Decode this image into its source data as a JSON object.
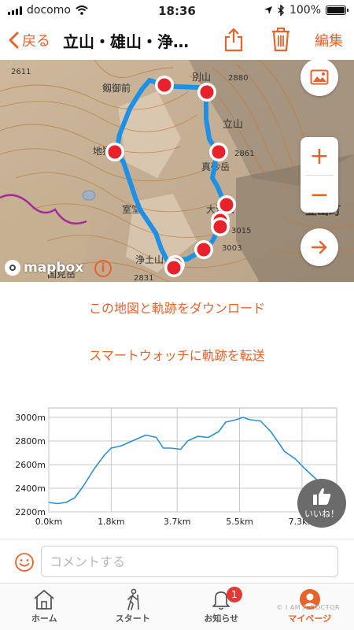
{
  "status_bar": {
    "carrier": "docomo",
    "time": "18:36",
    "battery": "100%"
  },
  "nav": {
    "back_label": "戻る",
    "title": "立山・雄山・浄…",
    "edit_label": "編集"
  },
  "map": {
    "provider": "mapbox",
    "labels": {
      "summit_2611": "2611",
      "tsurugi": "剱御前",
      "bessan": "別山",
      "elev_2880": "2880",
      "tateyama": "立山",
      "elev_2861": "2861",
      "masago": "真砂岳",
      "jigoku": "地獄",
      "murodo": "室堂",
      "oyama": "大汝山",
      "elev_3015": "3015",
      "elev_3003": "3003",
      "jodo": "浄土山",
      "kokken": "国見岳",
      "elev_2831": "2831",
      "town": "立山町"
    },
    "icons": {
      "image": "image-icon",
      "zoom_in": "plus-icon",
      "zoom_out": "minus-icon",
      "next": "arrow-right-icon",
      "info": "info-icon"
    },
    "zoom_in": "+",
    "zoom_out": "−",
    "info": "i"
  },
  "actions": {
    "download": "この地図と軌跡をダウンロード",
    "send_watch": "スマートウォッチに軌跡を転送"
  },
  "chart_data": {
    "type": "area",
    "x_unit": "km",
    "xlim": [
      0,
      8.3
    ],
    "ylim": [
      2200,
      3080
    ],
    "yticks": [
      "2200m",
      "2400m",
      "2600m",
      "2800m",
      "3000m"
    ],
    "ytick_values": [
      2200,
      2400,
      2600,
      2800,
      3000
    ],
    "xticks": [
      "0.0km",
      "1.8km",
      "3.7km",
      "5.5km",
      "7.3km"
    ],
    "xtick_values": [
      0,
      1.8,
      3.7,
      5.5,
      7.3
    ],
    "grid": true,
    "color": "#2b8fd6",
    "series": [
      {
        "x": [
          0,
          0.25,
          0.5,
          0.75,
          1.0,
          1.3,
          1.6,
          1.8,
          2.1,
          2.4,
          2.8,
          3.1,
          3.3,
          3.5,
          3.8,
          4.0,
          4.3,
          4.6,
          4.9,
          5.1,
          5.4,
          5.6,
          5.8,
          6.1,
          6.4,
          6.8,
          7.1,
          7.4,
          7.7,
          8.0
        ],
        "y": [
          2280,
          2270,
          2280,
          2320,
          2420,
          2560,
          2680,
          2740,
          2760,
          2800,
          2850,
          2830,
          2740,
          2740,
          2730,
          2800,
          2840,
          2830,
          2880,
          2960,
          2980,
          3000,
          2980,
          2970,
          2880,
          2710,
          2650,
          2560,
          2480,
          2390
        ]
      }
    ]
  },
  "like_button": {
    "label": "いいね！",
    "icon": "thumbs-up-icon"
  },
  "comment": {
    "placeholder": "コメントする",
    "value": ""
  },
  "tabs": [
    {
      "label": "ホーム",
      "icon": "home-icon",
      "active": false
    },
    {
      "label": "スタート",
      "icon": "hiker-icon",
      "active": false
    },
    {
      "label": "お知らせ",
      "icon": "bell-icon",
      "active": false,
      "badge": "1"
    },
    {
      "label": "マイページ",
      "icon": "user-icon",
      "active": true
    }
  ],
  "watermark": "© I AM A DOCTOR",
  "colors": {
    "accent": "#e8632a",
    "route": "#1e90e6",
    "marker": "#e8212a",
    "chart_line": "#2b8fd6"
  }
}
